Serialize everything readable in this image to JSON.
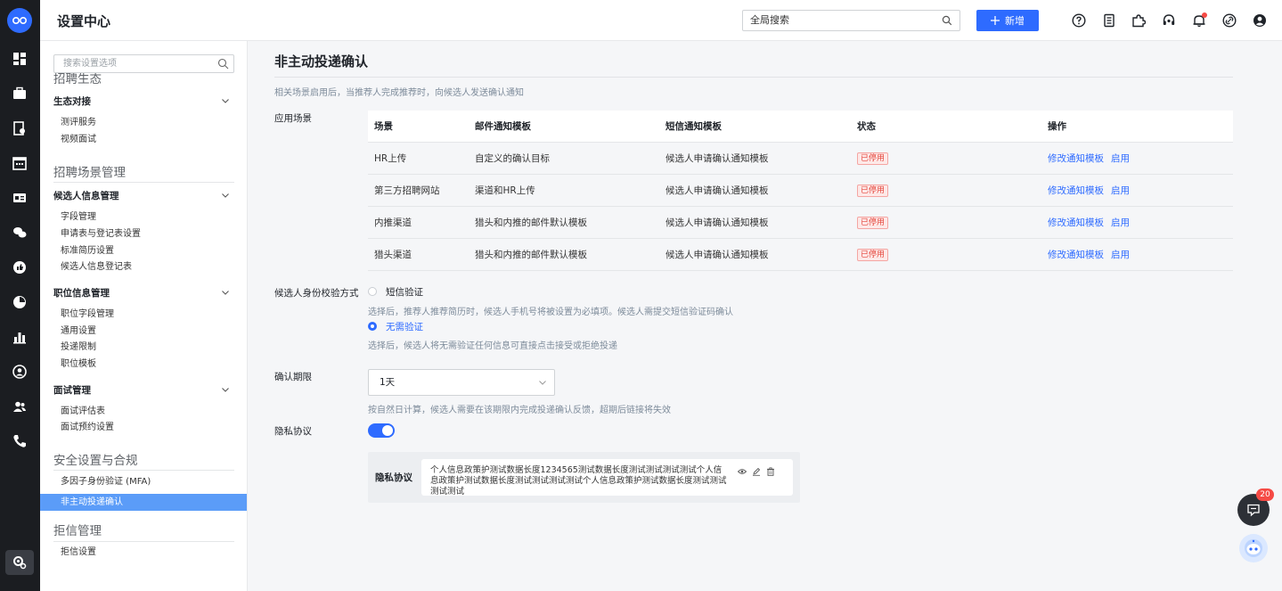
{
  "header": {
    "title": "设置中心",
    "search_value": "全局搜索",
    "new_button": "新增"
  },
  "sidebar": {
    "search_placeholder": "搜索设置选项",
    "groups": [
      {
        "title": "招聘生态"
      },
      {
        "title": "招聘场景管理"
      },
      {
        "title": "安全设置与合规"
      },
      {
        "title": "拒信管理"
      }
    ],
    "sections": {
      "eco": {
        "title": "生态对接",
        "items": [
          "测评服务",
          "视频面试"
        ]
      },
      "candidate": {
        "title": "候选人信息管理",
        "items": [
          "字段管理",
          "申请表与登记表设置",
          "标准简历设置",
          "候选人信息登记表"
        ]
      },
      "position": {
        "title": "职位信息管理",
        "items": [
          "职位字段管理",
          "通用设置",
          "投递限制",
          "职位模板"
        ]
      },
      "interview": {
        "title": "面试管理",
        "items": [
          "面试评估表",
          "面试预约设置"
        ]
      }
    },
    "security_items": [
      "多因子身份验证 (MFA)",
      "非主动投递确认"
    ],
    "reject_items": [
      "拒信设置"
    ]
  },
  "main": {
    "title": "非主动投递确认",
    "description": "相关场景启用后，当推荐人完成推荐时，向候选人发送确认通知",
    "scene_label": "应用场景",
    "table": {
      "columns": [
        "场景",
        "邮件通知模板",
        "短信通知模板",
        "状态",
        "操作"
      ],
      "rows": [
        {
          "scene": "HR上传",
          "email": "自定义的确认目标",
          "sms": "候选人申请确认通知模板",
          "status": "已停用",
          "edit": "修改通知模板",
          "enable": "启用"
        },
        {
          "scene": "第三方招聘网站",
          "email": "渠道和HR上传",
          "sms": "候选人申请确认通知模板",
          "status": "已停用",
          "edit": "修改通知模板",
          "enable": "启用"
        },
        {
          "scene": "内推渠道",
          "email": "猎头和内推的邮件默认模板",
          "sms": "候选人申请确认通知模板",
          "status": "已停用",
          "edit": "修改通知模板",
          "enable": "启用"
        },
        {
          "scene": "猎头渠道",
          "email": "猎头和内推的邮件默认模板",
          "sms": "候选人申请确认通知模板",
          "status": "已停用",
          "edit": "修改通知模板",
          "enable": "启用"
        }
      ]
    },
    "verify": {
      "label": "候选人身份校验方式",
      "options": [
        {
          "label": "短信验证",
          "hint": "选择后，推荐人推荐简历时，候选人手机号将被设置为必填项。候选人需提交短信验证码确认",
          "selected": false
        },
        {
          "label": "无需验证",
          "hint": "选择后，候选人将无需验证任何信息可直接点击接受或拒绝投递",
          "selected": true
        }
      ]
    },
    "deadline": {
      "label": "确认期限",
      "value": "1天",
      "hint": "按自然日计算，候选人需要在该期限内完成投递确认反馈，超期后链接将失效"
    },
    "privacy": {
      "label": "隐私协议",
      "enabled": true,
      "box_label": "隐私协议",
      "text": "个人信息政策护测试数据长度1234565测试数据长度测试测试测试测试个人信息政策护测试数据长度测试测试测试测试个人信息政策护测试数据长度测试测试测试测试"
    }
  },
  "floating": {
    "chat_badge": "20"
  }
}
